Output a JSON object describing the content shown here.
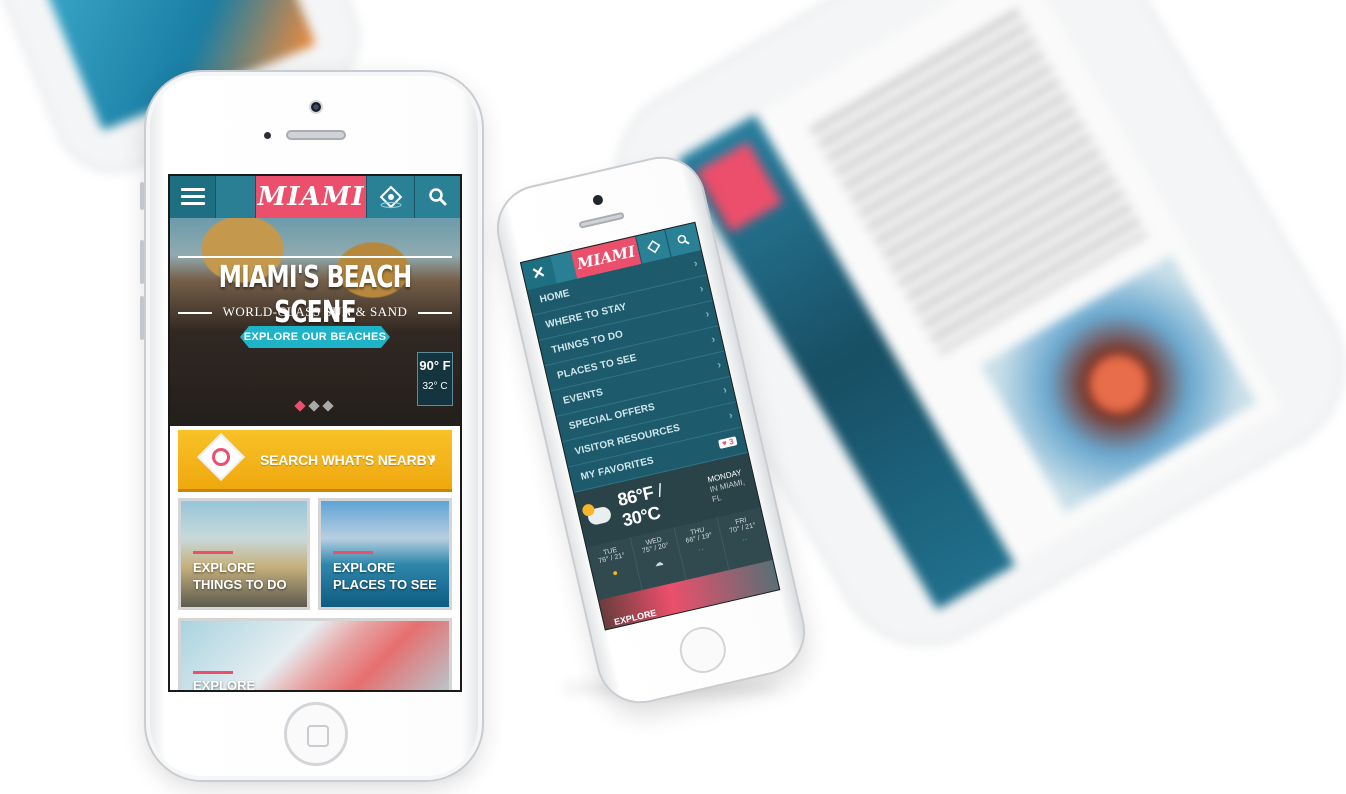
{
  "brand": {
    "logo": "MIAMI",
    "accent": "#ec4f6b",
    "teal": "#237a8f",
    "yellow": "#f5b729"
  },
  "main_phone": {
    "hero": {
      "title": "MIAMI'S BEACH SCENE",
      "subtitle": "WORLD-CLASS SUN & SAND",
      "cta": "EXPLORE OUR BEACHES",
      "temp_f": "90° F",
      "temp_c": "32° C",
      "slide_count": 3,
      "active_slide": 1
    },
    "nearby": {
      "label": "SEARCH WHAT'S NEARBY",
      "chevron": "›"
    },
    "tiles": [
      {
        "line1": "EXPLORE",
        "line2": "THINGS TO DO"
      },
      {
        "line1": "EXPLORE",
        "line2": "PLACES TO SEE"
      },
      {
        "line1": "EXPLORE",
        "line2": ""
      }
    ]
  },
  "menu_phone": {
    "close": "✕",
    "items": [
      "HOME",
      "WHERE TO STAY",
      "THINGS TO DO",
      "PLACES TO SEE",
      "EVENTS",
      "SPECIAL OFFERS",
      "VISITOR RESOURCES",
      "MY FAVORITES"
    ],
    "favorites_count": "♥ 3",
    "weather": {
      "temp_f": "86°F",
      "temp_c": "30°C",
      "day": "MONDAY",
      "location": "IN MIAMI, FL",
      "forecast": [
        {
          "day": "TUE",
          "temps": "76° / 21°"
        },
        {
          "day": "WED",
          "temps": "75° / 20°"
        },
        {
          "day": "THU",
          "temps": "66° / 19°"
        },
        {
          "day": "FRI",
          "temps": "70° / 21°"
        }
      ]
    },
    "footer_hint": "EXPLORE"
  }
}
